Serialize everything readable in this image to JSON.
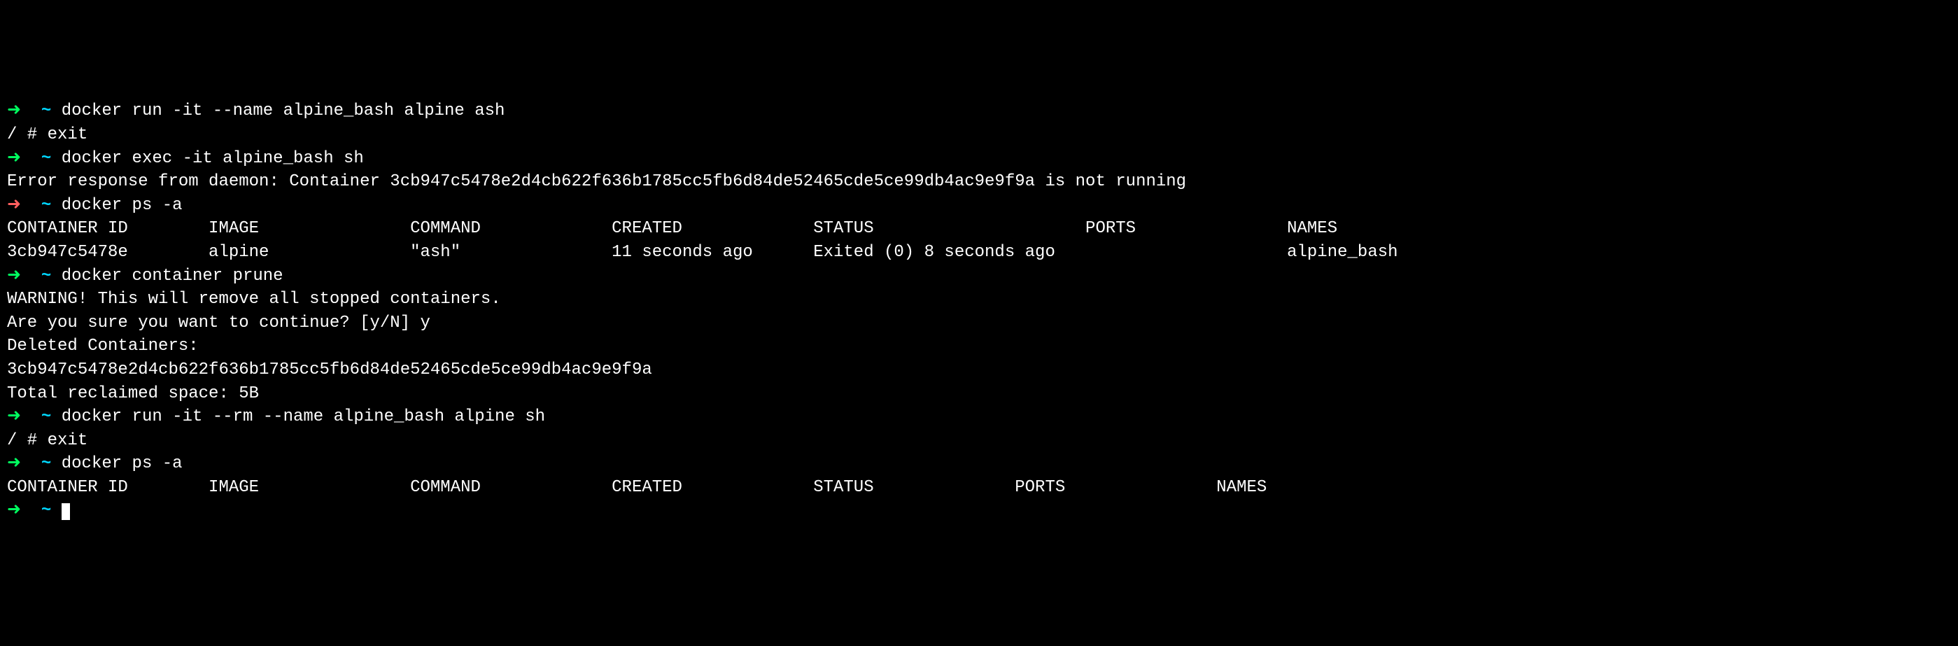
{
  "lines": [
    {
      "type": "prompt",
      "arrow": "green",
      "command": "docker run -it --name alpine_bash alpine ash"
    },
    {
      "type": "output",
      "text": "/ # exit"
    },
    {
      "type": "prompt",
      "arrow": "green",
      "command": "docker exec -it alpine_bash sh"
    },
    {
      "type": "output",
      "text": "Error response from daemon: Container 3cb947c5478e2d4cb622f636b1785cc5fb6d84de52465cde5ce99db4ac9e9f9a is not running"
    },
    {
      "type": "prompt",
      "arrow": "red",
      "command": "docker ps -a"
    },
    {
      "type": "output",
      "text": "CONTAINER ID        IMAGE               COMMAND             CREATED             STATUS                     PORTS               NAMES"
    },
    {
      "type": "output",
      "text": "3cb947c5478e        alpine              \"ash\"               11 seconds ago      Exited (0) 8 seconds ago                       alpine_bash"
    },
    {
      "type": "prompt",
      "arrow": "green",
      "command": "docker container prune"
    },
    {
      "type": "output",
      "text": "WARNING! This will remove all stopped containers."
    },
    {
      "type": "output",
      "text": "Are you sure you want to continue? [y/N] y"
    },
    {
      "type": "output",
      "text": "Deleted Containers:"
    },
    {
      "type": "output",
      "text": "3cb947c5478e2d4cb622f636b1785cc5fb6d84de52465cde5ce99db4ac9e9f9a"
    },
    {
      "type": "output",
      "text": ""
    },
    {
      "type": "output",
      "text": "Total reclaimed space: 5B"
    },
    {
      "type": "prompt",
      "arrow": "green",
      "command": "docker run -it --rm --name alpine_bash alpine sh"
    },
    {
      "type": "output",
      "text": "/ # exit"
    },
    {
      "type": "prompt",
      "arrow": "green",
      "command": "docker ps -a"
    },
    {
      "type": "output",
      "text": "CONTAINER ID        IMAGE               COMMAND             CREATED             STATUS              PORTS               NAMES"
    },
    {
      "type": "prompt-cursor",
      "arrow": "green",
      "command": ""
    }
  ],
  "symbols": {
    "arrow": "➜",
    "tilde": "~"
  }
}
